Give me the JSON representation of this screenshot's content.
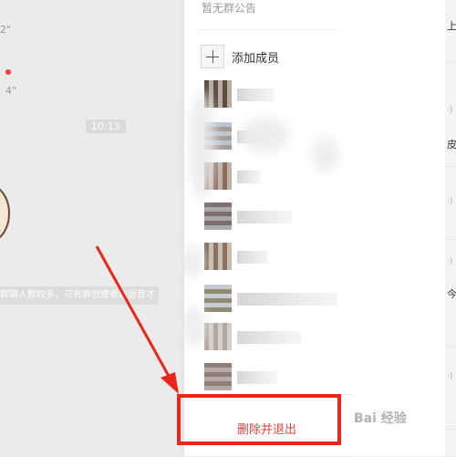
{
  "chat": {
    "voice_durations": [
      "2\"",
      "4\""
    ],
    "timestamp": "10:13",
    "system_notice": "群聊人数较多，只有群创建者赵运音才"
  },
  "panel": {
    "announcement": "暂无群公告",
    "add_member_label": "添加成员",
    "delete_exit_label": "删除并退出"
  },
  "right_strip": {
    "visible_glyphs": [
      "上",
      "皮",
      "今"
    ]
  },
  "watermark": "Bai 经验",
  "colors": {
    "danger_text": "#e64340",
    "annotation_red": "#e8261c",
    "chat_bg": "#ebebeb"
  },
  "icons": [
    "plus-icon",
    "sticker-image",
    "baidu-paw-icon",
    "arrow-annotation"
  ]
}
